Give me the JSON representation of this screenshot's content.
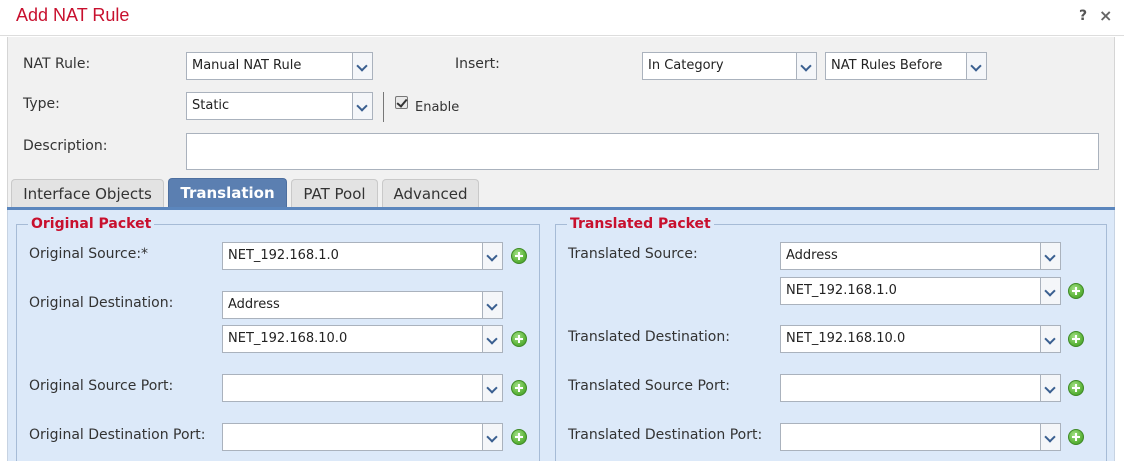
{
  "header": {
    "title": "Add NAT Rule",
    "help": "?",
    "close": "×"
  },
  "form": {
    "nat_rule_label": "NAT Rule:",
    "nat_rule_value": "Manual NAT Rule",
    "insert_label": "Insert:",
    "insert_value": "In Category",
    "insert_position_value": "NAT Rules Before",
    "type_label": "Type:",
    "type_value": "Static",
    "enable_label": "Enable",
    "enable_checked": true,
    "description_label": "Description:",
    "description_value": ""
  },
  "tabs": [
    {
      "label": "Interface Objects",
      "active": false
    },
    {
      "label": "Translation",
      "active": true
    },
    {
      "label": "PAT Pool",
      "active": false
    },
    {
      "label": "Advanced",
      "active": false
    }
  ],
  "original_packet": {
    "legend": "Original Packet",
    "source_label": "Original Source:*",
    "source_value": "NET_192.168.1.0",
    "destination_label": "Original Destination:",
    "destination_type_value": "Address",
    "destination_value": "NET_192.168.10.0",
    "source_port_label": "Original Source Port:",
    "source_port_value": "",
    "destination_port_label": "Original Destination Port:",
    "destination_port_value": ""
  },
  "translated_packet": {
    "legend": "Translated Packet",
    "source_label": "Translated Source:",
    "source_type_value": "Address",
    "source_value": "NET_192.168.1.0",
    "destination_label": "Translated Destination:",
    "destination_value": "NET_192.168.10.0",
    "source_port_label": "Translated Source Port:",
    "source_port_value": "",
    "destination_port_label": "Translated Destination Port:",
    "destination_port_value": ""
  },
  "colors": {
    "title": "#c8102e",
    "active_tab": "#5b7fb1",
    "panel_bg": "#dce9f9",
    "legend": "#c8102e",
    "add_icon": "#5db53b"
  },
  "icons": {
    "dropdown": "chevron-down-icon",
    "add": "plus-circle-icon",
    "help": "help-icon",
    "close": "close-icon"
  }
}
